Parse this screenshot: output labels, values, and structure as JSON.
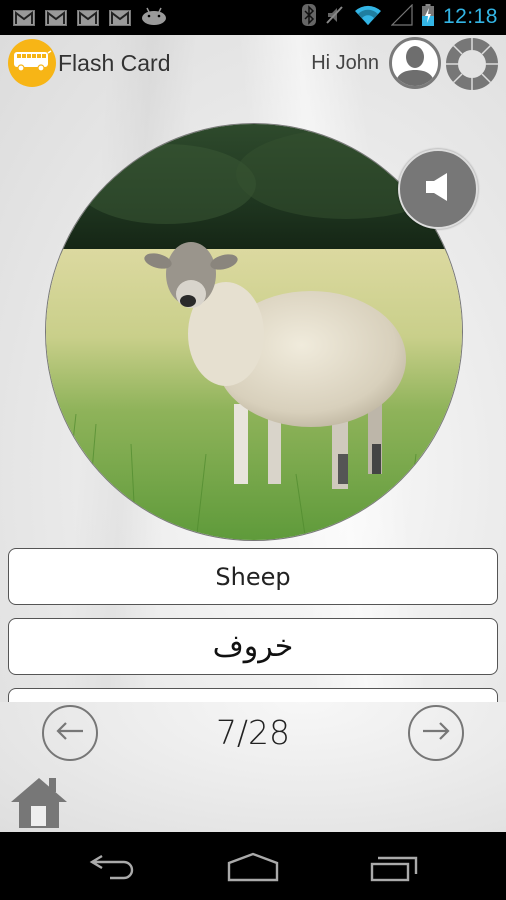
{
  "status_bar": {
    "notifications": [
      "gmail-icon",
      "gmail-icon",
      "gmail-icon",
      "gmail-icon",
      "android-icon"
    ],
    "system_icons": [
      "bluetooth-icon",
      "mute-icon",
      "wifi-icon",
      "signal-icon",
      "battery-charging-icon"
    ],
    "time": "12:18",
    "time_color": "#33b5e5"
  },
  "header": {
    "logo_icon": "bus-icon",
    "logo_color": "#f7b516",
    "title": "Flash Card",
    "greeting": "Hi John",
    "avatar_icon": "user-icon",
    "settings_icon": "ring-menu-icon"
  },
  "card": {
    "image_subject": "Sheep in a grassy field",
    "sound_icon": "speaker-icon",
    "word_english": "Sheep",
    "word_arabic": "خروف",
    "word_third": ""
  },
  "navigation": {
    "prev_icon": "arrow-left-icon",
    "next_icon": "arrow-right-icon",
    "current": 7,
    "total": 28,
    "counter_text": "7/28",
    "home_icon": "home-icon"
  },
  "system_nav": {
    "back_icon": "back-icon",
    "home_icon": "home-outline-icon",
    "recents_icon": "recents-icon"
  }
}
